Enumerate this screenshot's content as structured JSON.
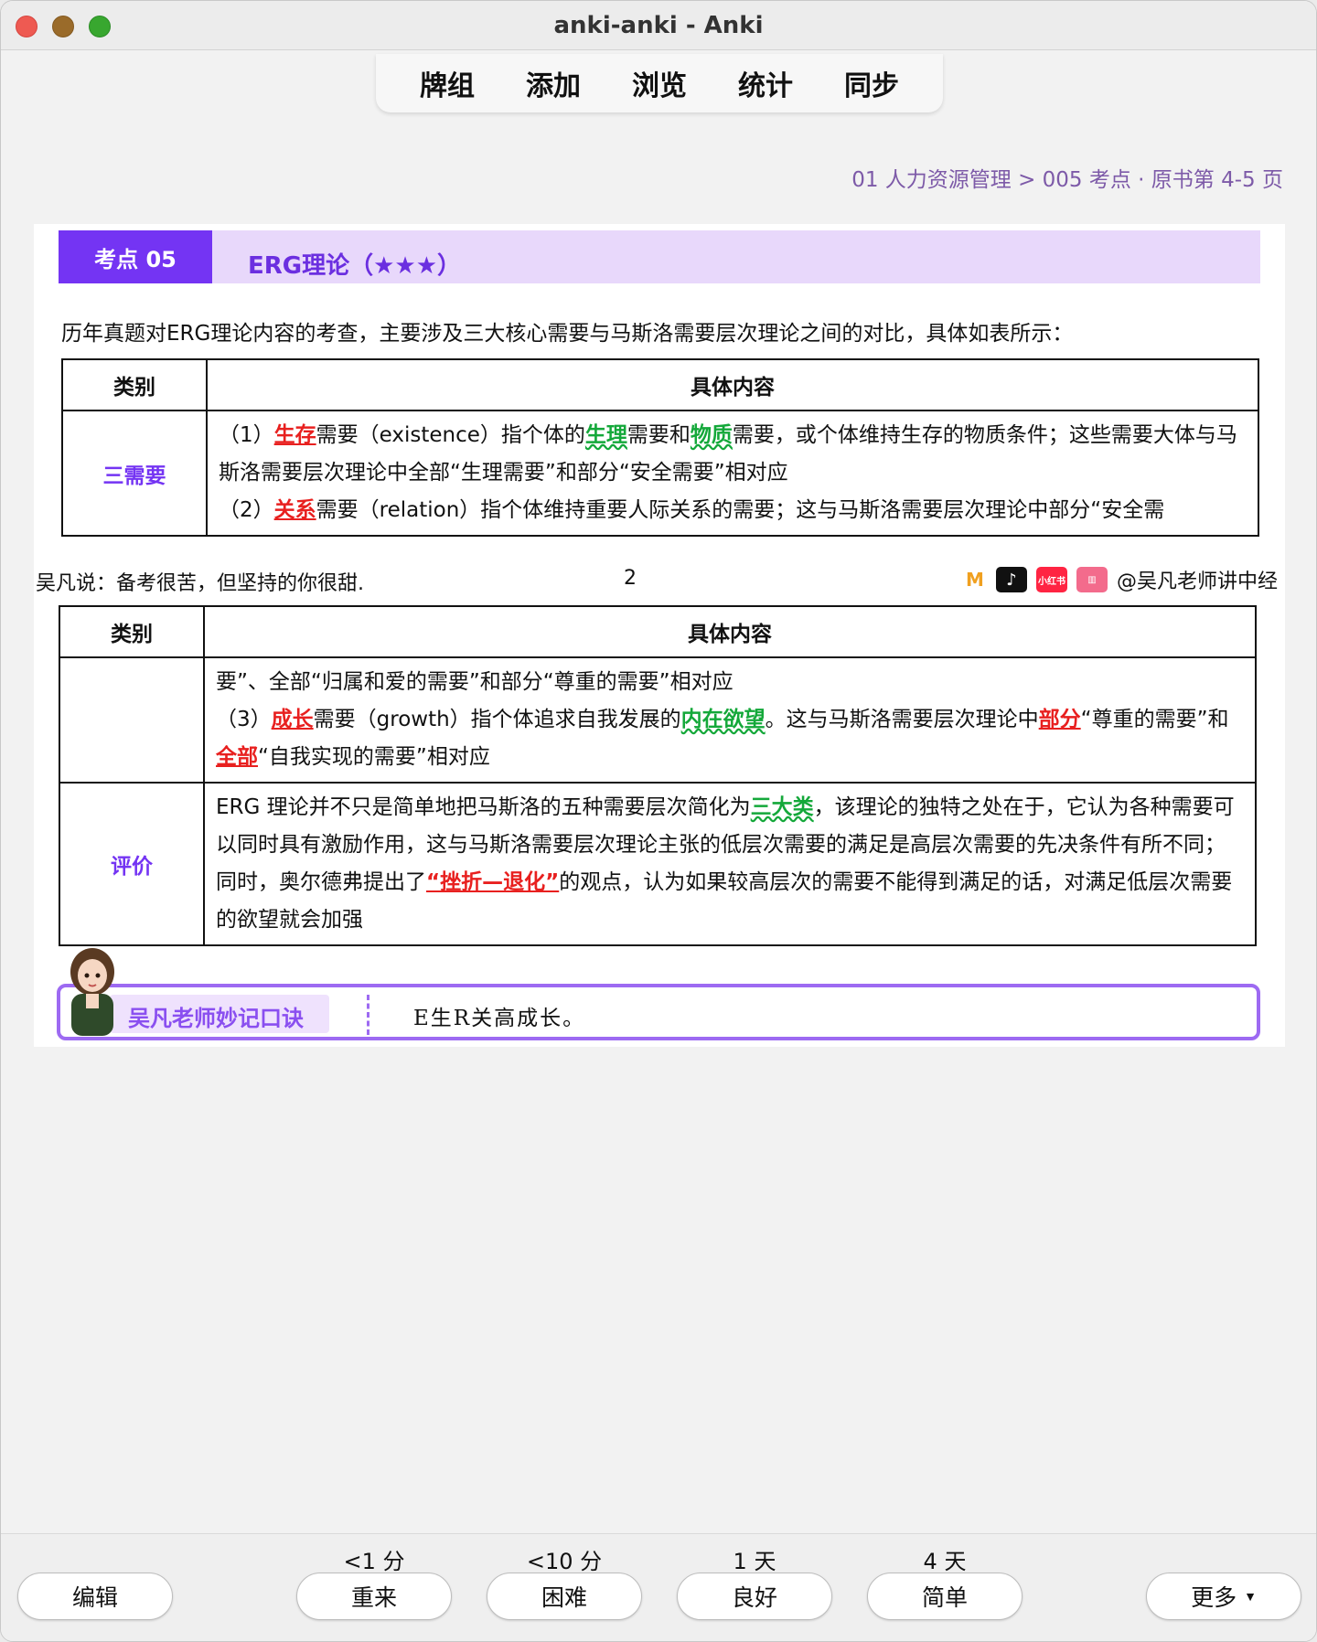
{
  "window": {
    "title": "anki-anki - Anki"
  },
  "nav": [
    "牌组",
    "添加",
    "浏览",
    "统计",
    "同步"
  ],
  "breadcrumb": "01 人力资源管理 > 005 考点 · 原书第 4-5 页",
  "card": {
    "tag": "考点 05",
    "title": "ERG理论（★★★）",
    "intro": "历年真题对ERG理论内容的考查，主要涉及三大核心需要与马斯洛需要层次理论之间的对比，具体如表所示：",
    "table_headers": {
      "category": "类别",
      "content": "具体内容"
    },
    "row1_category": "三需要",
    "row1": {
      "p1_a": "（1）",
      "p1_red": "生存",
      "p1_b": "需要（existence）指个体的",
      "p1_g1": "生理",
      "p1_c": "需要和",
      "p1_g2": "物质",
      "p1_d": "需要，或个体维持生存的物质条件；这些需要大体与马斯洛需要层次理论中全部“生理需要”和部分“安全需要”相对应",
      "p2_a": "（2）",
      "p2_red": "关系",
      "p2_b": "需要（relation）指个体维持重要人际关系的需要；这与马斯洛需要层次理论中部分“安全需"
    },
    "footer": {
      "motto": "吴凡说：备考很苦，但坚持的你很甜.",
      "page": "2",
      "handle": "@吴凡老师讲中经"
    },
    "row2": {
      "p1": "要”、全部“归属和爱的需要”和部分“尊重的需要”相对应",
      "p2_a": "（3）",
      "p2_red": "成长",
      "p2_b": "需要（growth）指个体追求自我发展的",
      "p2_g": "内在欲望",
      "p2_c": "。这与马斯洛需要层次理论中",
      "p2_red2": "部分",
      "p2_d": "“尊重的需要”和",
      "p2_red3": "全部",
      "p2_e": "“自我实现的需要”相对应"
    },
    "row3_category": "评价",
    "row3": {
      "a": "ERG 理论并不只是简单地把马斯洛的五种需要层次简化为",
      "g": "三大类",
      "b": "，该理论的独特之处在于，它认为各种需要可以同时具有激励作用，这与马斯洛需要层次理论主张的低层次需要的满足是高层次需要的先决条件有所不同；同时，奥尔德弗提出了",
      "red": "“挫折—退化”",
      "c": "的观点，认为如果较高层次的需要不能得到满足的话，对满足低层次需要的欲望就会加强"
    },
    "mnemonic_label": "吴凡老师妙记口诀",
    "mnemonic_text": "E生R关高成长。"
  },
  "answer": {
    "edit": "编辑",
    "more": "更多",
    "buttons": [
      {
        "due": "<1 分",
        "label": "重来"
      },
      {
        "due": "<10 分",
        "label": "困难"
      },
      {
        "due": "1 天",
        "label": "良好"
      },
      {
        "due": "4 天",
        "label": "简单"
      }
    ]
  }
}
